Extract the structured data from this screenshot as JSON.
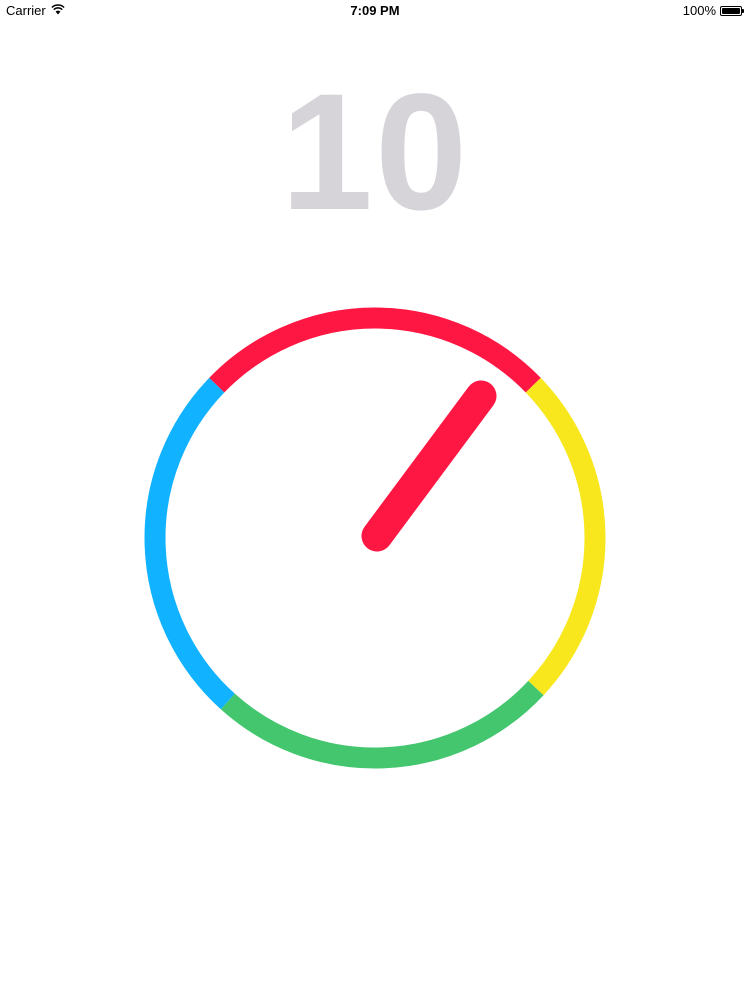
{
  "status_bar": {
    "carrier": "Carrier",
    "time": "7:09 PM",
    "battery_text": "100%",
    "battery_level": 1.0,
    "wifi_icon": "wifi-icon",
    "battery_icon": "battery-icon"
  },
  "game": {
    "score": "10",
    "colors": {
      "red": "#FF1744",
      "yellow": "#F7E71C",
      "green": "#43C66E",
      "blue": "#11B2FF",
      "score_text": "#D6D4D8"
    },
    "ring_segments": [
      {
        "name": "ring-segment-red",
        "color": "#FF1744"
      },
      {
        "name": "ring-segment-yellow",
        "color": "#F7E71C"
      },
      {
        "name": "ring-segment-green",
        "color": "#43C66E"
      },
      {
        "name": "ring-segment-blue",
        "color": "#11B2FF"
      }
    ],
    "needle": {
      "color": "#FF1744"
    }
  }
}
